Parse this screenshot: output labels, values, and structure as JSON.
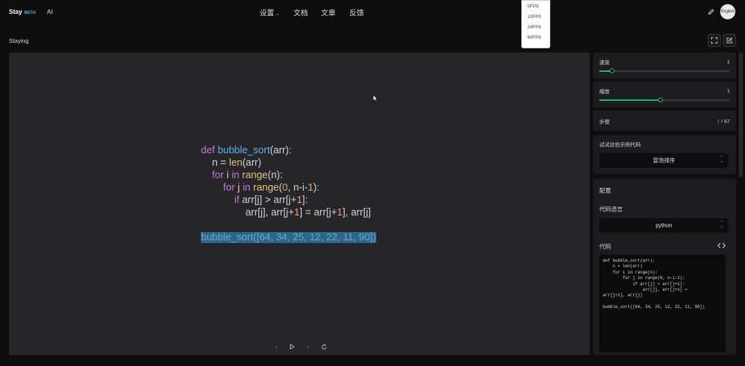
{
  "header": {
    "brand": "Stay",
    "beta": "BETA",
    "ai": "AI",
    "nav": [
      "设置",
      "文档",
      "文章",
      "反馈"
    ],
    "lang": "English"
  },
  "fps_menu": [
    "5FPS",
    "10FPS",
    "24FPS",
    "60FPS"
  ],
  "subbar": {
    "title": "Staying"
  },
  "stage": {
    "code_lines": [
      "def bubble_sort(arr):",
      "    n = len(arr)",
      "    for i in range(n):",
      "        for j in range(0, n-i-1):",
      "            if arr[j] > arr[j+1]:",
      "                arr[j], arr[j+1] = arr[j+1], arr[j]",
      "",
      "bubble_sort([64, 34, 25, 12, 22, 11, 90])"
    ]
  },
  "controls": {
    "speed": {
      "label": "速度",
      "value": "1",
      "level": 0.1
    },
    "zoom": {
      "label": "缩放",
      "value": "1",
      "level": 0.47
    },
    "steps": {
      "label": "步骤",
      "current": "1",
      "total": "/ 67"
    },
    "example": {
      "label": "试试这些示例代码",
      "selected": "冒泡排序"
    }
  },
  "config": {
    "title": "配置",
    "language_label": "代码语言",
    "language_selected": "python",
    "code_label": "代码",
    "code_text": "def bubble_sort(arr):\n    n = len(arr)\n    for i in range(n):\n        for j in range(0, n-i-1):\n            if arr[j] > arr[j+1]:\n                arr[j], arr[j+1] =\narr[j+1], arr[j]\n\nbubble_sort([64, 34, 25, 12, 22, 11, 90])"
  },
  "colors": {
    "accent": "#19c37d",
    "beta": "#39c0c9",
    "keyword": "#c678dd",
    "function": "#61afef",
    "builtin": "#e5c07b",
    "number": "#e9a56c",
    "highlight": "#2f6585"
  }
}
